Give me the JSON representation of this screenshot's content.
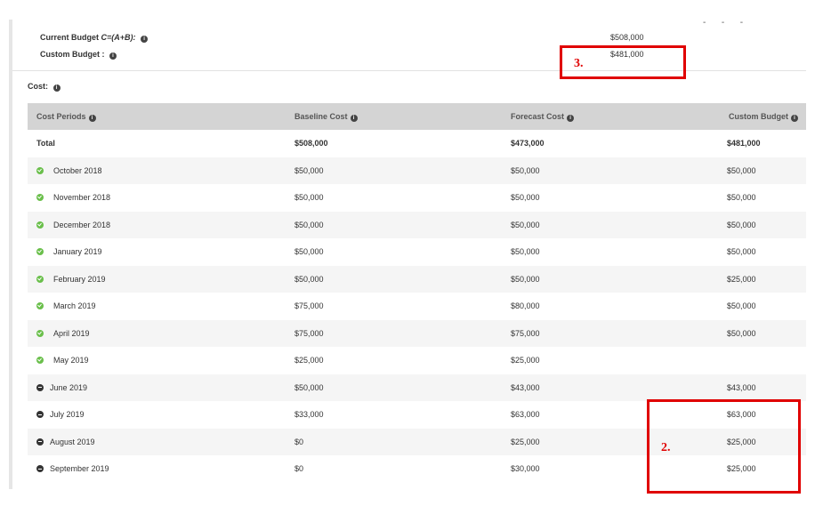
{
  "summary": {
    "current_budget_label": "Current Budget",
    "current_budget_formula": "C=(A+B):",
    "current_budget_value": "$508,000",
    "custom_budget_label": "Custom Budget :",
    "custom_budget_value": "$481,000"
  },
  "cost_section": {
    "title": "Cost:"
  },
  "table": {
    "headers": {
      "period": "Cost Periods",
      "baseline": "Baseline Cost",
      "forecast": "Forecast Cost",
      "custom": "Custom Budget"
    },
    "total": {
      "label": "Total",
      "baseline": "$508,000",
      "forecast": "$473,000",
      "custom": "$481,000"
    },
    "rows": [
      {
        "status": "complete",
        "period": "October 2018",
        "baseline": "$50,000",
        "forecast": "$50,000",
        "custom": "$50,000"
      },
      {
        "status": "complete",
        "period": "November 2018",
        "baseline": "$50,000",
        "forecast": "$50,000",
        "custom": "$50,000"
      },
      {
        "status": "complete",
        "period": "December 2018",
        "baseline": "$50,000",
        "forecast": "$50,000",
        "custom": "$50,000"
      },
      {
        "status": "complete",
        "period": "January 2019",
        "baseline": "$50,000",
        "forecast": "$50,000",
        "custom": "$50,000"
      },
      {
        "status": "complete",
        "period": "February 2019",
        "baseline": "$50,000",
        "forecast": "$50,000",
        "custom": "$25,000"
      },
      {
        "status": "complete",
        "period": "March 2019",
        "baseline": "$75,000",
        "forecast": "$80,000",
        "custom": "$50,000"
      },
      {
        "status": "complete",
        "period": "April 2019",
        "baseline": "$75,000",
        "forecast": "$75,000",
        "custom": "$50,000"
      },
      {
        "status": "complete",
        "period": "May 2019",
        "baseline": "$25,000",
        "forecast": "$25,000",
        "custom": ""
      },
      {
        "status": "pending",
        "period": "June 2019",
        "baseline": "$50,000",
        "forecast": "$43,000",
        "custom": "$43,000"
      },
      {
        "status": "pending",
        "period": "July 2019",
        "baseline": "$33,000",
        "forecast": "$63,000",
        "custom": "$63,000"
      },
      {
        "status": "pending",
        "period": "August 2019",
        "baseline": "$0",
        "forecast": "$25,000",
        "custom": "$25,000"
      },
      {
        "status": "pending",
        "period": "September 2019",
        "baseline": "$0",
        "forecast": "$30,000",
        "custom": "$25,000"
      }
    ]
  },
  "annotations": {
    "callout_summary": "3.",
    "callout_custom_column": "2."
  },
  "colors": {
    "complete": "#6abf4b",
    "pending": "#333333",
    "header_bg": "#d4d4d4",
    "callout": "#e00000"
  }
}
